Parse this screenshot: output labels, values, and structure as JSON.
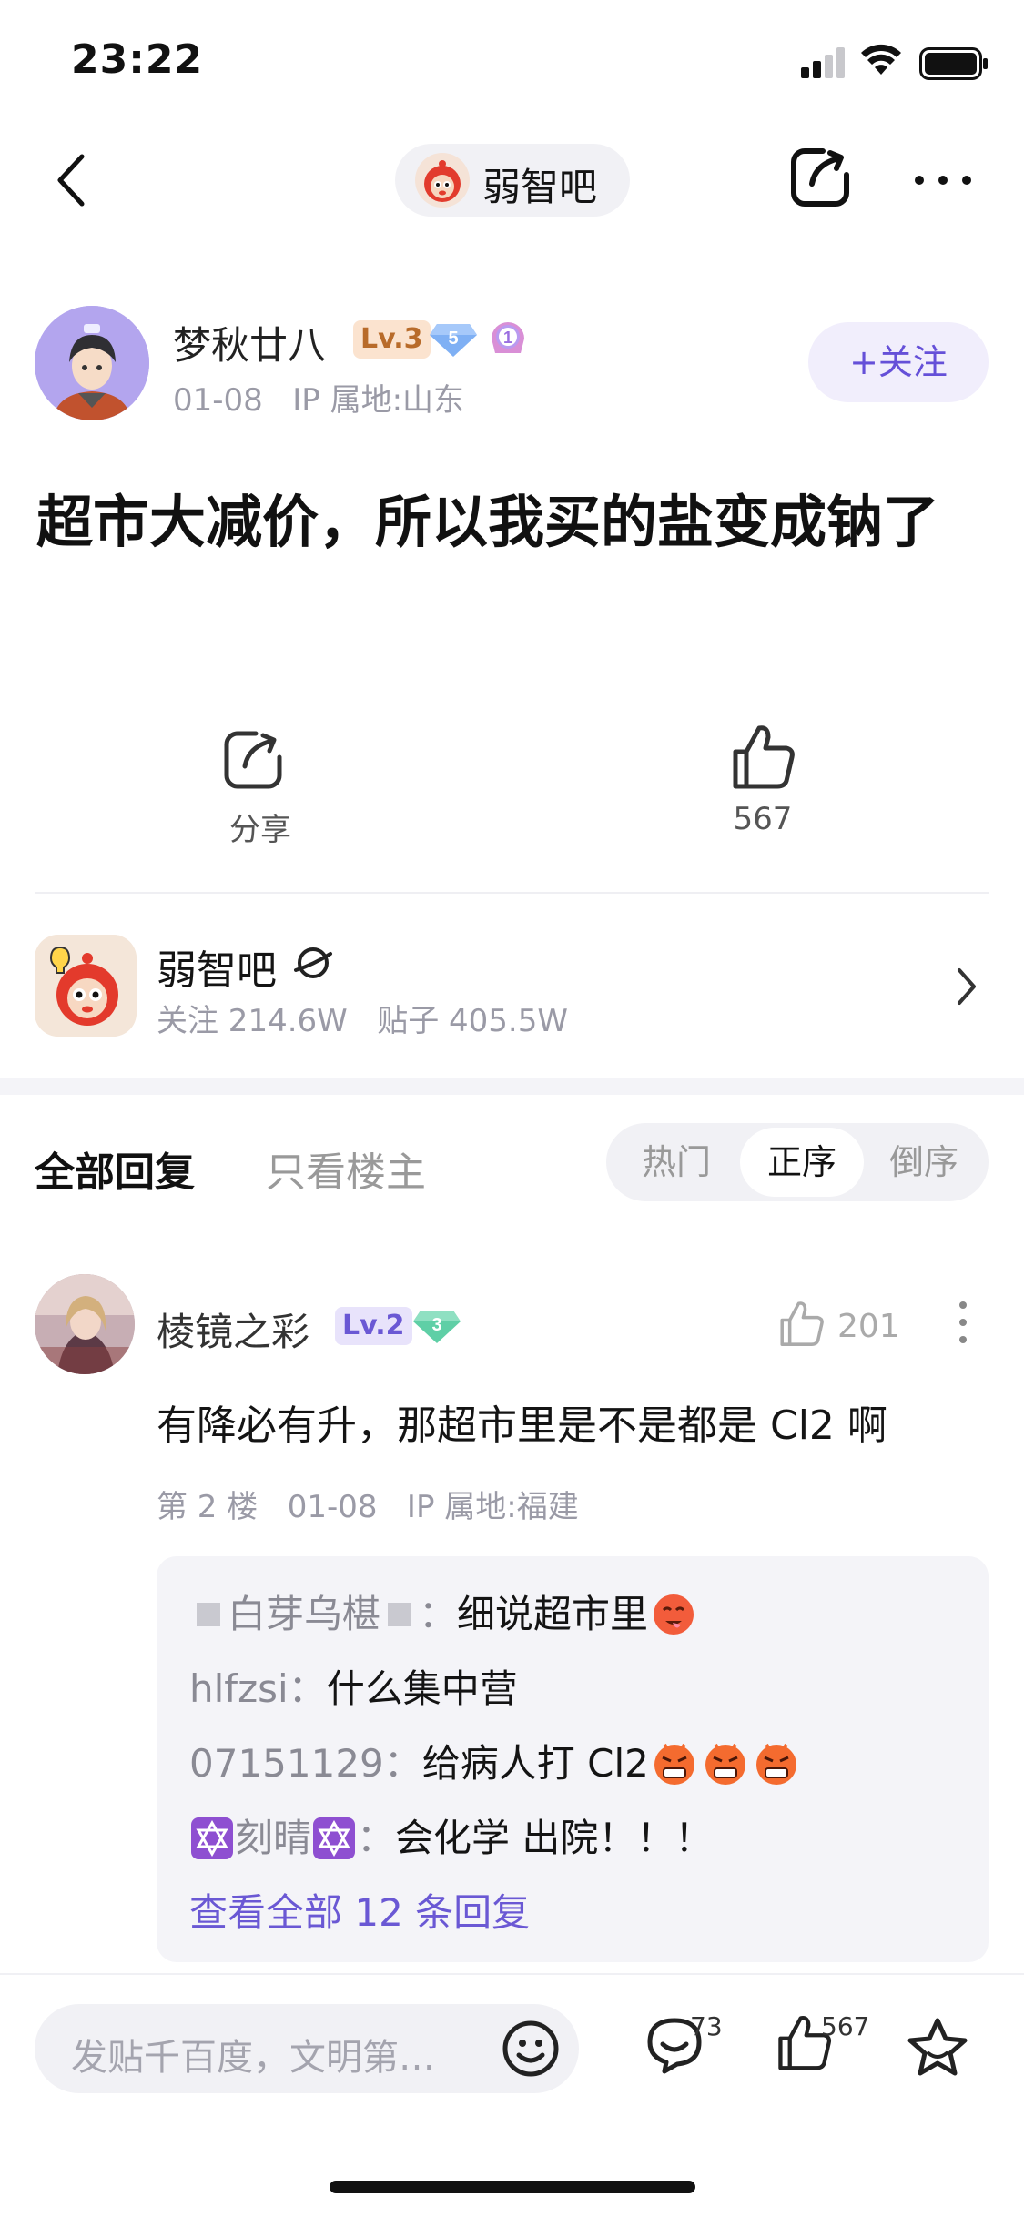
{
  "status_bar": {
    "time": "23:22"
  },
  "nav": {
    "forum_name": "弱智吧"
  },
  "author": {
    "name": "梦秋廿八",
    "level": "Lv.3",
    "gem_level": "5",
    "badge": "1",
    "date": "01-08",
    "ip": "IP 属地:山东",
    "follow_label": "+关注"
  },
  "post": {
    "title": "超市大减价，所以我买的盐变成钠了"
  },
  "actions": {
    "share_label": "分享",
    "like_count": "567"
  },
  "forum_card": {
    "name": "弱智吧",
    "followers": "关注 214.6W",
    "posts": "贴子 405.5W"
  },
  "tabs": {
    "all": "全部回复",
    "op_only": "只看楼主"
  },
  "sort": {
    "hot": "热门",
    "asc": "正序",
    "desc": "倒序"
  },
  "reply": {
    "name": "棱镜之彩",
    "level": "Lv.2",
    "gem_level": "3",
    "like_count": "201",
    "text": "有降必有升，那超市里是不是都是 Cl2 啊",
    "floor": "第 2 楼",
    "date": "01-08",
    "ip": "IP 属地:福建",
    "sub_replies": [
      {
        "user": "白芽乌椹",
        "text": "细说超市里"
      },
      {
        "user": "hlfzsi",
        "text": "什么集中营"
      },
      {
        "user": "07151129",
        "text": "给病人打 Cl2"
      },
      {
        "user": "刻晴",
        "text": "会化学 出院！！！"
      }
    ],
    "view_all": "查看全部 12 条回复"
  },
  "bottom": {
    "input_placeholder": "发贴千百度，文明第…",
    "comment_count": "73",
    "like_count": "567"
  },
  "colors": {
    "accent": "#6550d8",
    "muted": "#9a9aa6",
    "pill_bg": "#f1f1f5"
  }
}
